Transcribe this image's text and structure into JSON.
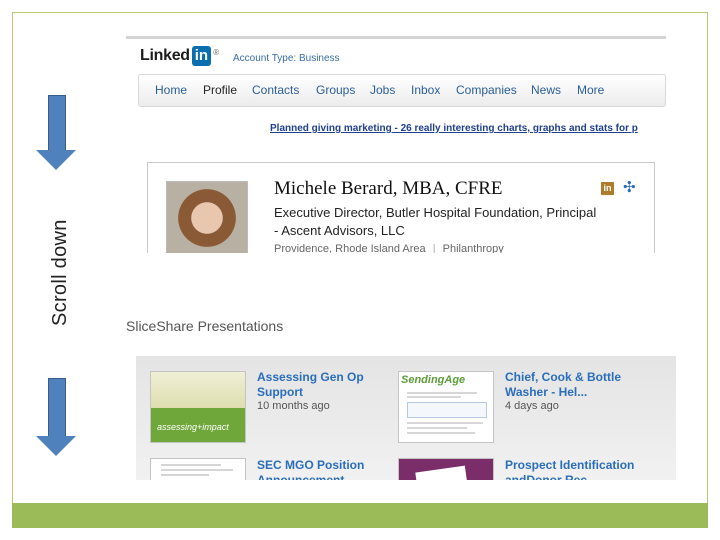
{
  "scroll_label": "Scroll down",
  "linkedin": {
    "logo_text": "Linked",
    "logo_box": "in",
    "logo_reg": "®",
    "account_type": "Account Type: Business",
    "nav": [
      "Home",
      "Profile",
      "Contacts",
      "Groups",
      "Jobs",
      "Inbox",
      "Companies",
      "News",
      "More"
    ],
    "active_nav": "Profile",
    "banner_link": "Planned giving marketing - 26 really interesting charts, graphs and stats for p",
    "profile": {
      "name": "Michele Berard, MBA, CFRE",
      "headline": "Executive Director, Butler Hospital Foundation, Principal - Ascent Advisors, LLC",
      "location": "Providence, Rhode Island Area",
      "separator": "|",
      "industry": "Philanthropy"
    }
  },
  "slideshare": {
    "section_title": "SliceShare Presentations",
    "items": [
      {
        "title": "Assessing Gen Op Support",
        "age": "10 months ago",
        "thumb_text": "assessing+impact"
      },
      {
        "title": "Chief, Cook & Bottle Washer - Hel...",
        "age": "4 days ago",
        "thumb_text": "SendingAge"
      },
      {
        "title": "SEC MGO Position Announcement",
        "age": ""
      },
      {
        "title": "Prospect Identification andDonor Rec...",
        "age": ""
      }
    ]
  },
  "colors": {
    "accent_green": "#9bbb59",
    "arrow_blue": "#4f81bd",
    "link_blue": "#2a6ebb",
    "linkedin_blue": "#0a6fae"
  }
}
